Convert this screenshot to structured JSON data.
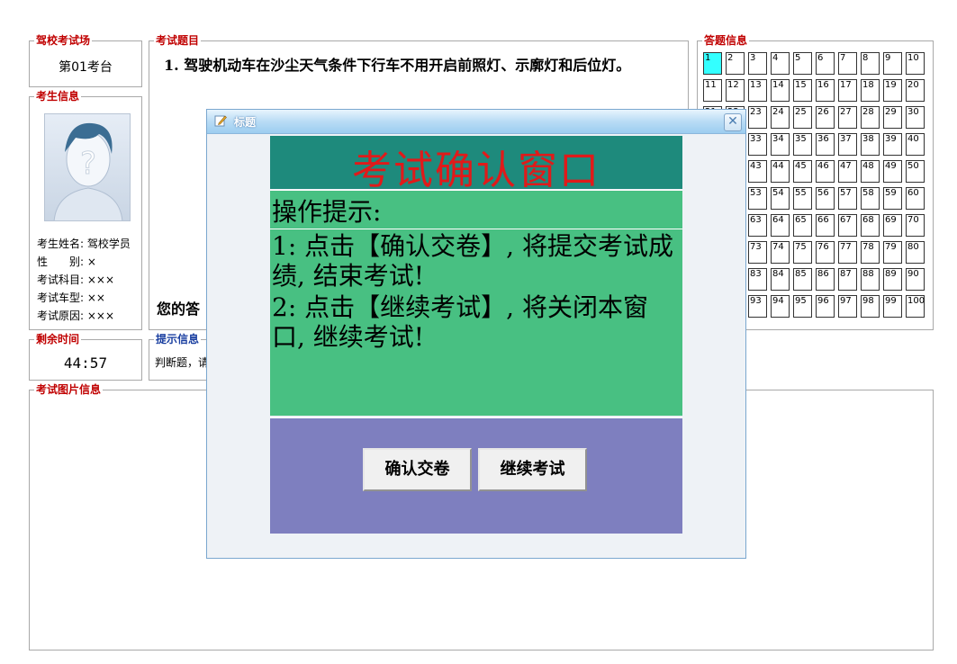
{
  "venue": {
    "legend": "驾校考试场",
    "seat": "第01考台"
  },
  "question": {
    "legend": "考试题目",
    "text": "1. 驾驶机动车在沙尘天气条件下行车不用开启前照灯、示廓灯和后位灯。",
    "answer_label": "您的答"
  },
  "student": {
    "legend": "考生信息",
    "fields": [
      "考生姓名: 驾校学员",
      "性　　别: ×",
      "考试科目: ×××",
      "考试车型: ××",
      "考试原因: ×××"
    ]
  },
  "timer": {
    "legend": "剩余时间",
    "value": "44:57"
  },
  "hint": {
    "legend": "提示信息",
    "text": "判断题，请"
  },
  "answers": {
    "legend": "答题信息",
    "count": 100,
    "current": 1,
    "highlight_color": "#33ffff"
  },
  "pics": {
    "legend": "考试图片信息"
  },
  "dialog": {
    "title": "标题",
    "header": "考试确认窗口",
    "tip_title": "操作提示:",
    "tip1": "1: 点击【确认交卷】, 将提交考试成绩, 结束考试!",
    "tip2": "2: 点击【继续考试】, 将关闭本窗口, 继续考试!",
    "confirm_label": "确认交卷",
    "continue_label": "继续考试",
    "colors": {
      "header_bg": "#1e8a7c",
      "header_text": "#e01a1a",
      "body_bg": "#48c082",
      "button_area_bg": "#7e7fbf"
    }
  }
}
